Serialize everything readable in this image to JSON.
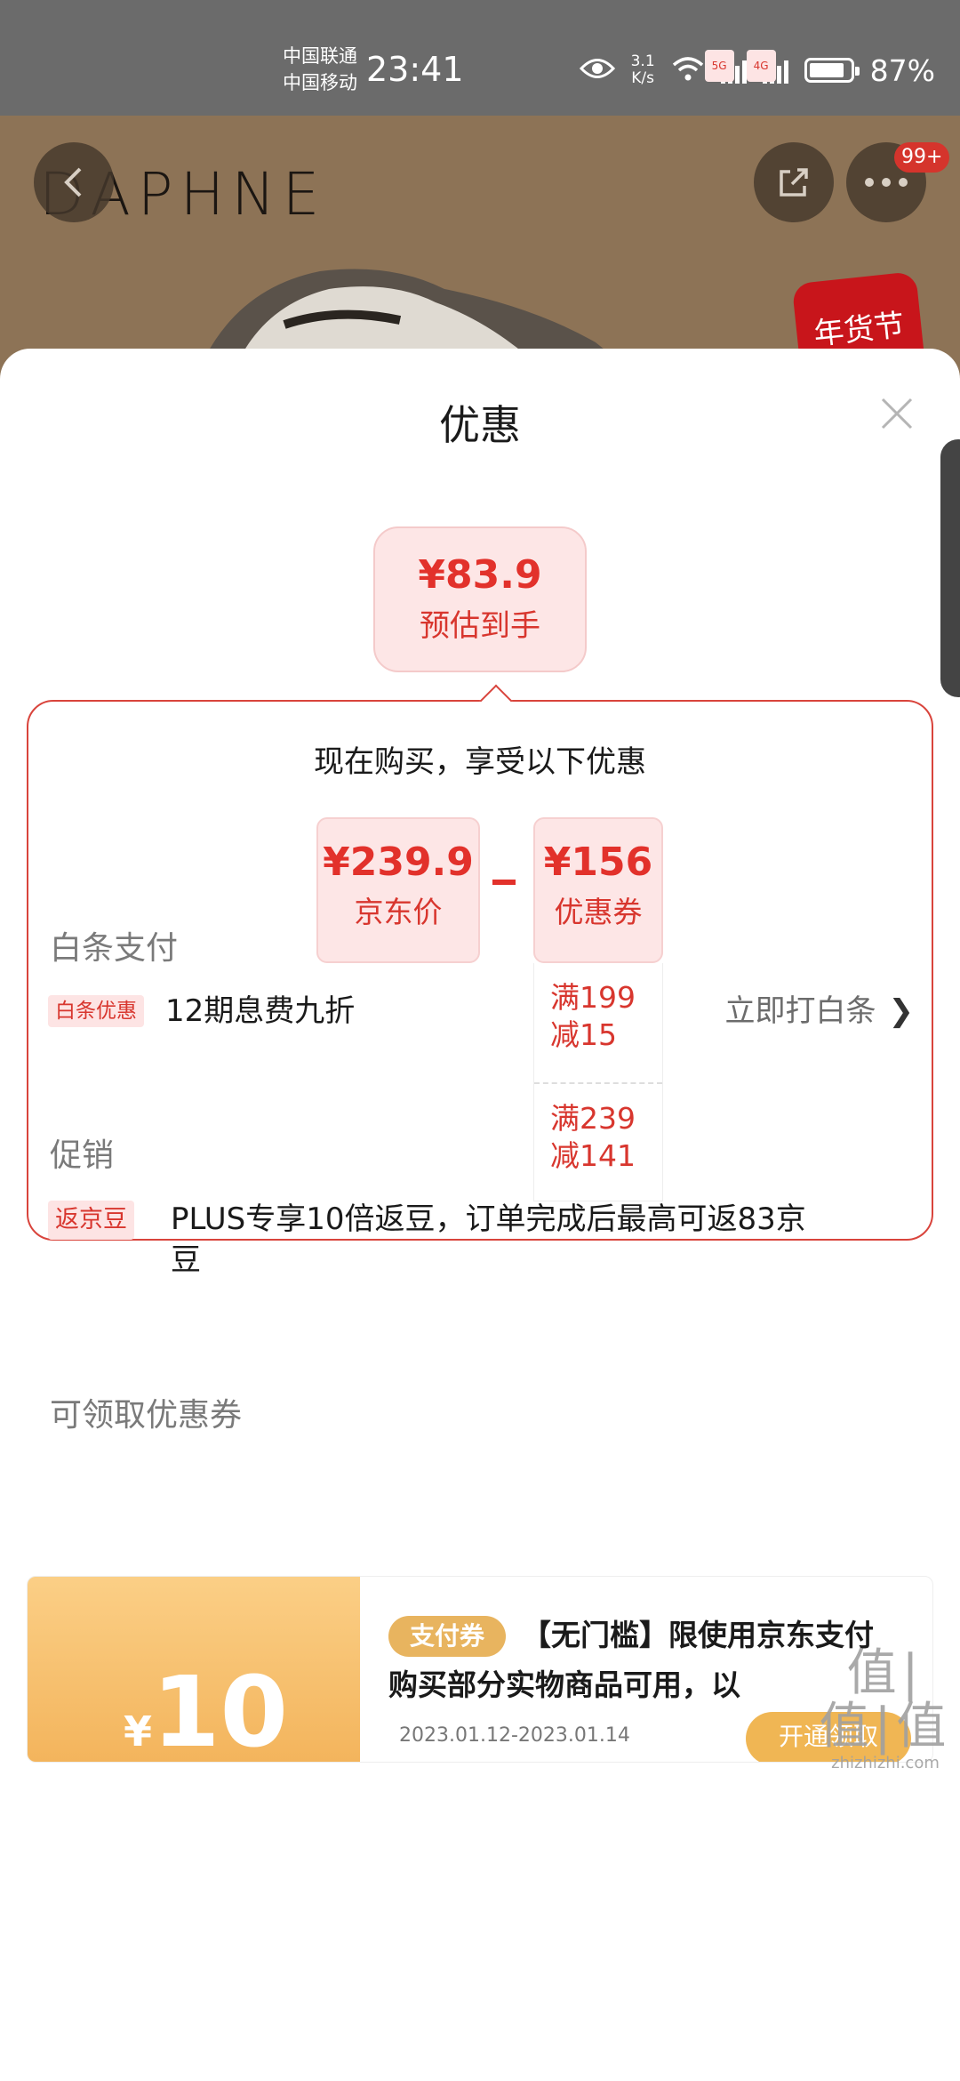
{
  "status_bar": {
    "carrier_1": "中国联通",
    "carrier_2": "中国移动",
    "time": "23:41",
    "net_speed_value": "3.1",
    "net_speed_unit": "K/s",
    "sig1_tag": "5G",
    "sig2_tag": "4G",
    "battery": "87%"
  },
  "product": {
    "brand": "DAPHNE",
    "message_badge": "99+",
    "festival_tag": "年货节"
  },
  "sheet": {
    "title": "优惠",
    "estimate": {
      "price": "¥83.9",
      "label": "预估到手"
    },
    "promo": {
      "heading": "现在购买，享受以下优惠",
      "jd_price": {
        "value": "¥239.9",
        "label": "京东价"
      },
      "coupon": {
        "value": "¥156",
        "label": "优惠券"
      },
      "rules": [
        {
          "line1": "满199",
          "line2": "减15"
        },
        {
          "line1": "满239",
          "line2": "减141"
        }
      ]
    },
    "baitiao": {
      "section_title": "白条支付",
      "tag": "白条优惠",
      "text": "12期息费九折",
      "action": "立即打白条",
      "chevron": "❯"
    },
    "promotion": {
      "section_title": "促销",
      "tag": "返京豆",
      "text_line1": "PLUS专享10倍返豆，订单完成后最高可返83京",
      "text_line2": "豆"
    },
    "coupons": {
      "section_title": "可领取优惠券",
      "card": {
        "yen": "¥",
        "amount": "10",
        "tag": "支付券",
        "desc": "【无门槛】限使用京东支付购买部分实物商品可用，以",
        "date": "2023.01.12-2023.01.14",
        "button": "开通领取"
      }
    }
  },
  "watermark": {
    "mark": "值|值|值",
    "url": "zhizhizhi.com"
  },
  "colors": {
    "accent_red": "#e2312b",
    "tag_bg": "#fde4e4",
    "coupon_gold": "#f3b45c"
  }
}
